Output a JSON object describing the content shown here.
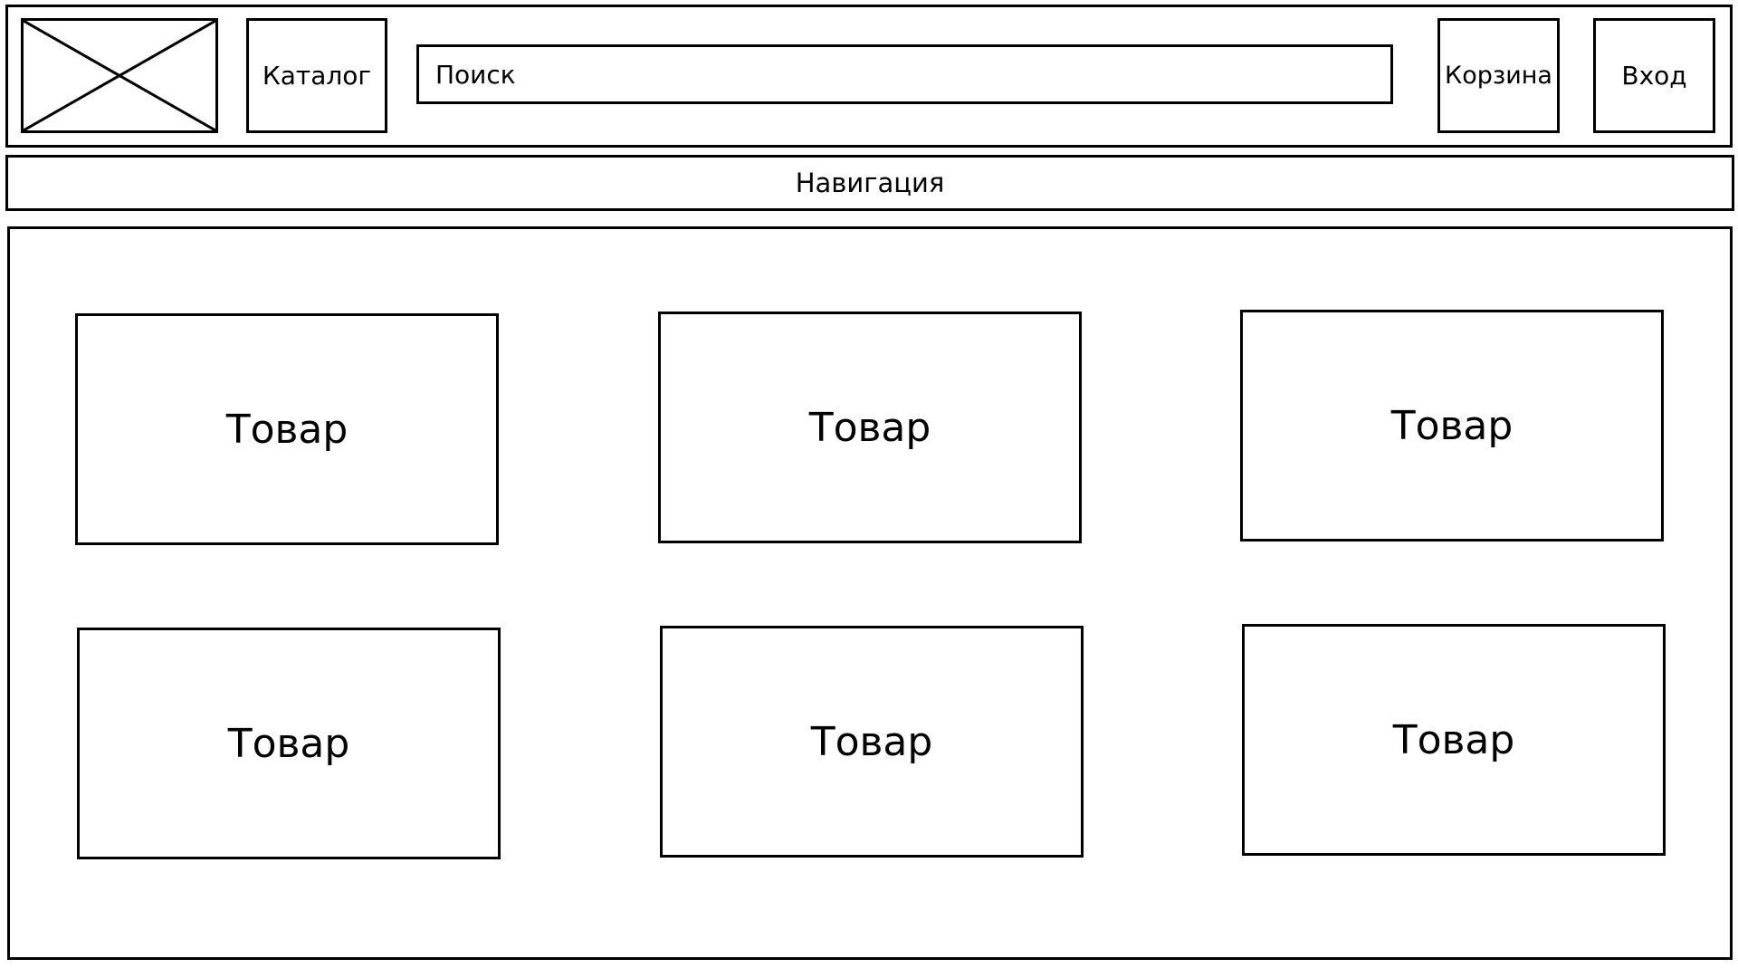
{
  "header": {
    "logo_icon": "image-placeholder-icon",
    "catalog_label": "Каталог",
    "search_placeholder": "Поиск",
    "cart_label": "Корзина",
    "login_label": "Вход"
  },
  "navigation": {
    "label": "Навигация"
  },
  "products": [
    {
      "label": "Товар"
    },
    {
      "label": "Товар"
    },
    {
      "label": "Товар"
    },
    {
      "label": "Товар"
    },
    {
      "label": "Товар"
    },
    {
      "label": "Товар"
    }
  ],
  "colors": {
    "stroke": "#000000",
    "background": "#ffffff"
  }
}
